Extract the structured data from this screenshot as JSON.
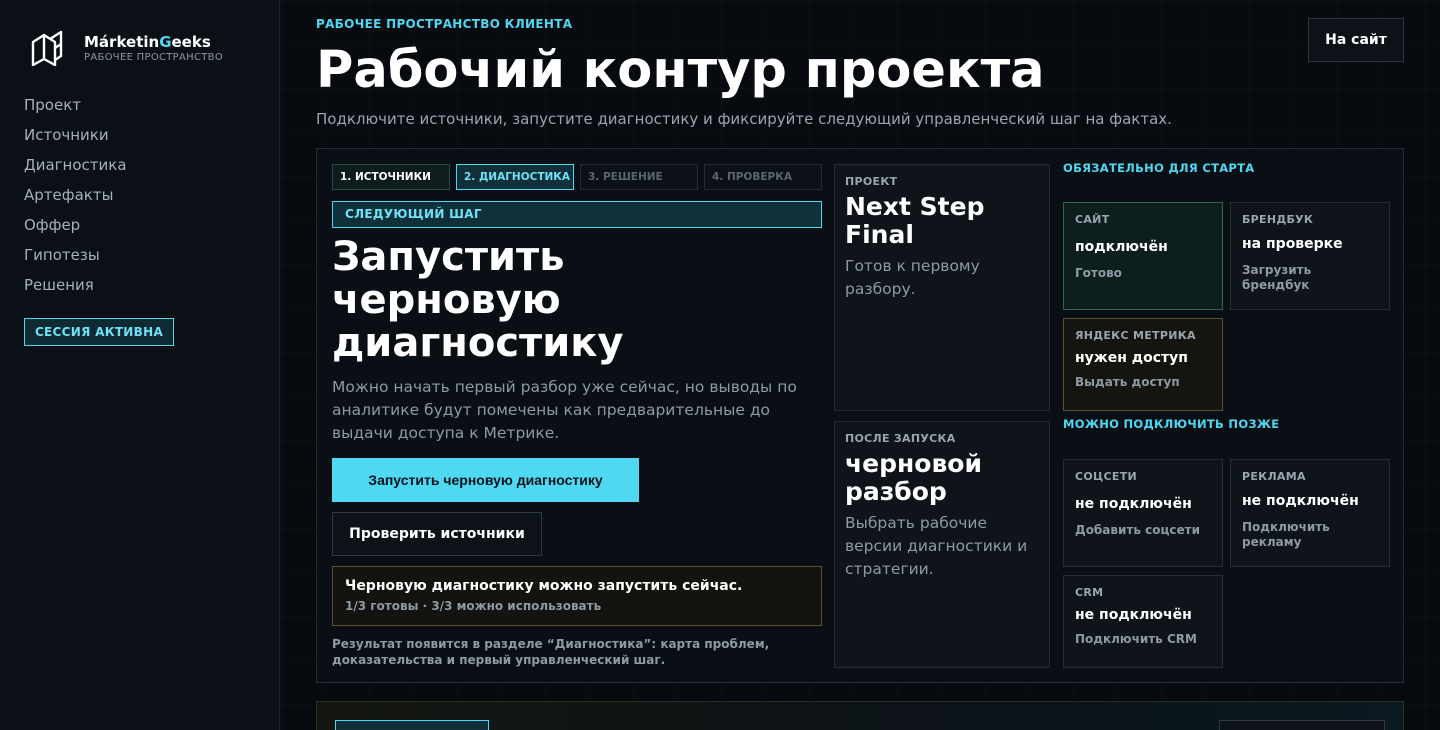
{
  "sidebar": {
    "brand_prefix": "Márketin",
    "brand_accent": "G",
    "brand_suffix": "eeks",
    "brand_sub": "РАБОЧЕЕ ПРОСТРАНСТВО",
    "nav": [
      "Проект",
      "Источники",
      "Диагностика",
      "Артефакты",
      "Оффер",
      "Гипотезы",
      "Решения"
    ],
    "session": "СЕССИЯ АКТИВНА"
  },
  "header": {
    "eyebrow": "РАБОЧЕЕ ПРОСТРАНСТВО КЛИЕНТА",
    "title": "Рабочий контур проекта",
    "subtitle": "Подключите источники, запустите диагностику и фиксируйте следующий управленческий шаг на фактах.",
    "site_button": "На сайт"
  },
  "steps": [
    "1. ИСТОЧНИКИ",
    "2. ДИАГНОСТИКА",
    "3. РЕШЕНИЕ",
    "4. ПРОВЕРКА"
  ],
  "next": {
    "label": "СЛЕДУЮЩИЙ ШАГ",
    "title_l1": "Запустить",
    "title_l2": "черновую",
    "title_l3": "диагностику",
    "desc": "Можно начать первый разбор уже сейчас, но выводы по аналитике будут помечены как предварительные до выдачи доступа к Метрике.",
    "primary": "Запустить черновую диагностику",
    "secondary": "Проверить источники",
    "notice_title": "Черновую диагностику можно запустить сейчас.",
    "notice_sub": "1/3 готовы · 3/3 можно использовать",
    "footnote": "Результат появится в разделе “Диагностика”: карта проблем, доказательства и первый управленческий шаг."
  },
  "project_card": {
    "label": "ПРОЕКТ",
    "value_l1": "Next Step",
    "value_l2": "Final",
    "desc": "Готов к первому разбору."
  },
  "after_card": {
    "label": "ПОСЛЕ ЗАПУСКА",
    "value_l1": "черновой",
    "value_l2": "разбор",
    "desc": "Выбрать рабочие версии диагностики и стратегии."
  },
  "required": {
    "label": "ОБЯЗАТЕЛЬНО ДЛЯ СТАРТА",
    "items": [
      {
        "name": "САЙТ",
        "status": "подключён",
        "action": "Готово"
      },
      {
        "name": "БРЕНДБУК",
        "status": "на проверке",
        "action": "Загрузить брендбук"
      },
      {
        "name": "ЯНДЕКС МЕТРИКА",
        "status": "нужен доступ",
        "action": "Выдать доступ"
      }
    ]
  },
  "optional": {
    "label": "МОЖНО ПОДКЛЮЧИТЬ ПОЗЖЕ",
    "items": [
      {
        "name": "СОЦСЕТИ",
        "status": "не подключён",
        "action": "Добавить соцсети"
      },
      {
        "name": "РЕКЛАМА",
        "status": "не подключён",
        "action": "Подключить рекламу"
      },
      {
        "name": "CRM",
        "status": "не подключён",
        "action": "Подключить CRM"
      }
    ]
  },
  "colors": {
    "accent": "#4fd8f2",
    "background": "#070a0e",
    "ok": "#2a6a52",
    "warn": "#5a4f2e"
  }
}
